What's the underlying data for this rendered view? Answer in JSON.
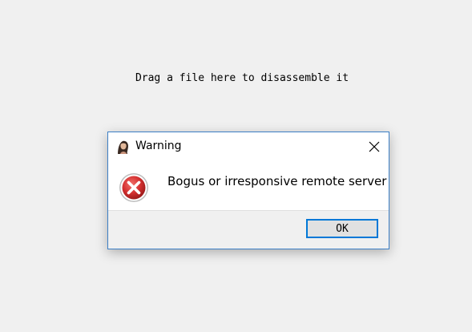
{
  "main": {
    "drop_hint": "Drag a file here to disassemble it"
  },
  "dialog": {
    "title": "Warning",
    "title_icon": "portrait-app-icon",
    "icon": "error-x-icon",
    "message": "Bogus or irresponsive remote server",
    "ok_label": "OK",
    "close_icon": "close-icon"
  },
  "colors": {
    "background": "#f0f0f0",
    "dialog_border": "#3c7fc6",
    "button_focus_border": "#0078d7",
    "error_red": "#d32f2f"
  }
}
